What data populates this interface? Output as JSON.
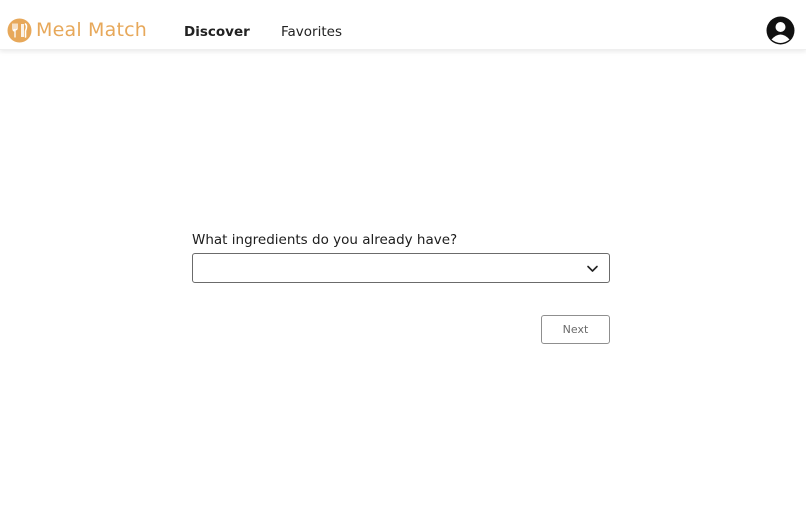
{
  "app": {
    "brand_name": "Meal Match",
    "brand_color": "#e7a85a",
    "logo_icon": "utensils-icon"
  },
  "nav": {
    "items": [
      {
        "label": "Discover",
        "active": true
      },
      {
        "label": "Favorites",
        "active": false
      }
    ],
    "account_icon": "user-circle-icon"
  },
  "form": {
    "question": "What ingredients do you already have?",
    "ingredients_select": {
      "value": "",
      "icon": "chevron-down-icon"
    },
    "next_label": "Next"
  }
}
